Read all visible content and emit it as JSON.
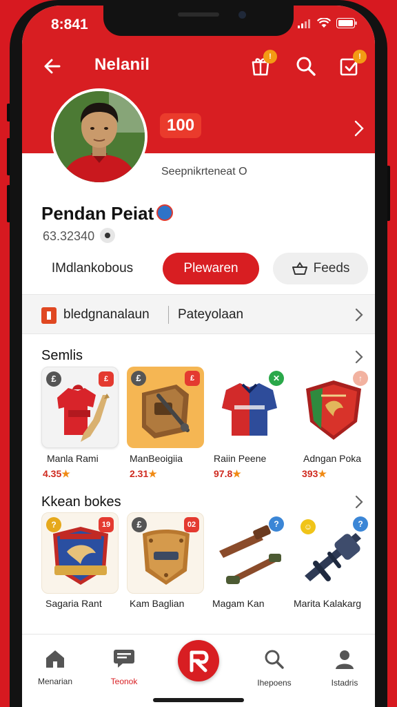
{
  "status": {
    "time": "8:841"
  },
  "topbar": {
    "title": "Nelanil",
    "badge_a": "!",
    "badge_b": "!"
  },
  "profile": {
    "score": "100",
    "subinfo": "Seepnikrteneat O",
    "name": "Pendan Peiat",
    "uid": "63.32340"
  },
  "actions": {
    "left": "IMdlankobous",
    "primary": "Plewaren",
    "secondary": "Feeds"
  },
  "category": {
    "first": "bledgnanalaun",
    "second": "Pateyolaan"
  },
  "section1": {
    "title": "Semlis",
    "items": [
      {
        "name": "Manla Rami",
        "price": "4.35",
        "badge_left": "£",
        "badge_right": "£"
      },
      {
        "name": "ManBeoigiia",
        "price": "2.31",
        "badge_left": "£",
        "badge_right": "£"
      },
      {
        "name": "Raiin Peene",
        "price": "97.8",
        "badge_right": "✕"
      },
      {
        "name": "Adngan Poka",
        "price": "393",
        "badge_right": "↑"
      }
    ]
  },
  "section2": {
    "title": "Kkean bokes",
    "items": [
      {
        "name": "Sagaria Rant",
        "badge_left": "?",
        "badge_right": "19"
      },
      {
        "name": "Kam Baglian",
        "badge_left": "£",
        "badge_right": "02"
      },
      {
        "name": "Magam Kan",
        "badge_right": "?"
      },
      {
        "name": "Marita Kalakarg",
        "badge_left": "☺",
        "badge_right": "?"
      }
    ]
  },
  "tabs": [
    {
      "label": "Menarian",
      "icon": "home-icon"
    },
    {
      "label": "Teonok",
      "icon": "chat-icon"
    },
    {
      "label": "",
      "icon": "logo-icon"
    },
    {
      "label": "Ihepoens",
      "icon": "search-icon"
    },
    {
      "label": "Istadris",
      "icon": "profile-icon"
    }
  ],
  "colors": {
    "brand": "#d81e22",
    "accent": "#f39b14",
    "price": "#cf2a1f"
  }
}
